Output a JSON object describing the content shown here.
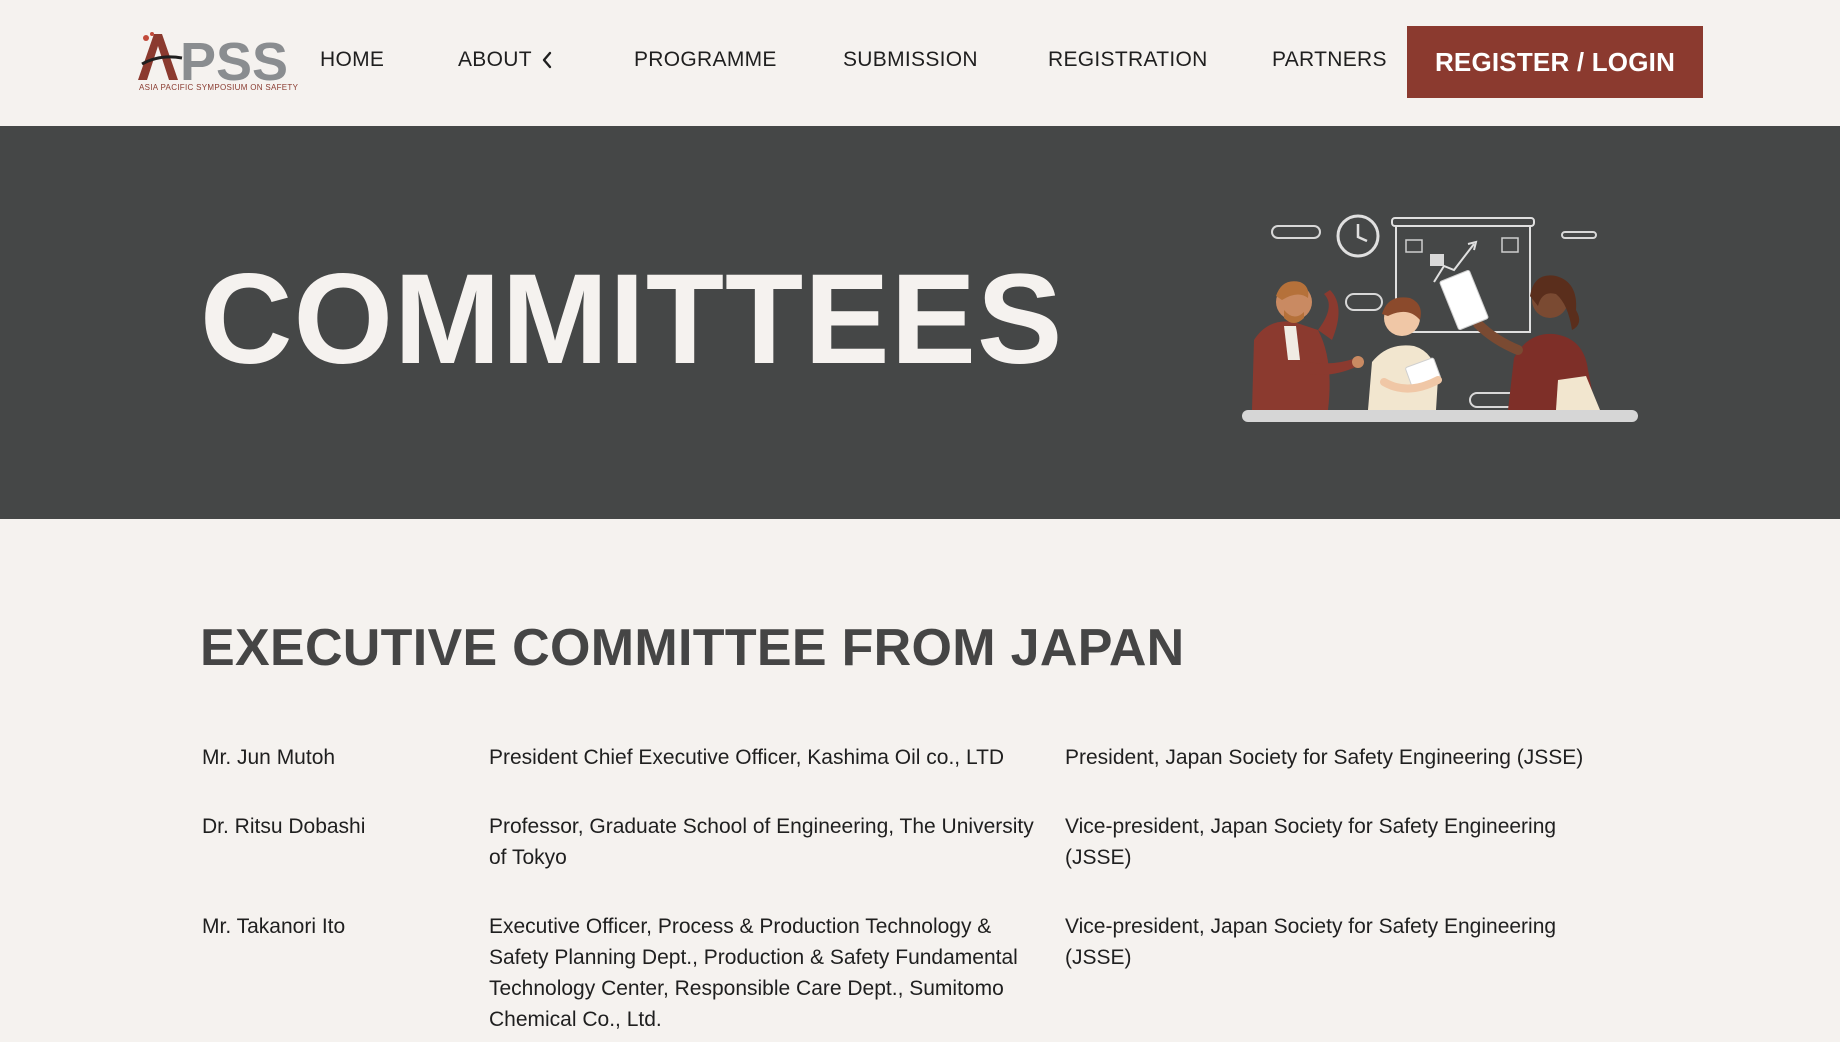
{
  "header": {
    "logo_text": "APSS",
    "logo_subtitle": "ASIA PACIFIC SYMPOSIUM ON SAFETY",
    "nav": [
      "HOME",
      "ABOUT",
      "PROGRAMME",
      "SUBMISSION",
      "REGISTRATION",
      "PARTNERS"
    ],
    "cta_label": "REGISTER / LOGIN",
    "icons": {
      "about_toggle": "chevron-left-icon"
    }
  },
  "hero": {
    "title": "COMMITTEES",
    "illustration": "team-meeting-illustration"
  },
  "section": {
    "title": "EXECUTIVE COMMITTEE FROM JAPAN",
    "members": [
      {
        "name": "Mr. Jun Mutoh",
        "role": "President Chief Executive Officer, Kashima Oil co., LTD",
        "society": "President, Japan Society for Safety Engineering (JSSE)"
      },
      {
        "name": "Dr. Ritsu Dobashi",
        "role": "Professor, Graduate School of Engineering, The University of Tokyo",
        "society": "Vice-president, Japan Society for Safety Engineering (JSSE)"
      },
      {
        "name": "Mr. Takanori Ito",
        "role": "Executive Officer, Process & Production Technology & Safety Planning Dept., Production & Safety Fundamental Technology Center, Responsible Care Dept., Sumitomo Chemical Co., Ltd.",
        "society": "Vice-president, Japan Society for Safety Engineering (JSSE)"
      }
    ]
  },
  "colors": {
    "background": "#f5f2ef",
    "hero_bg": "#454747",
    "accent": "#8b3a2f",
    "heading": "#454545"
  }
}
